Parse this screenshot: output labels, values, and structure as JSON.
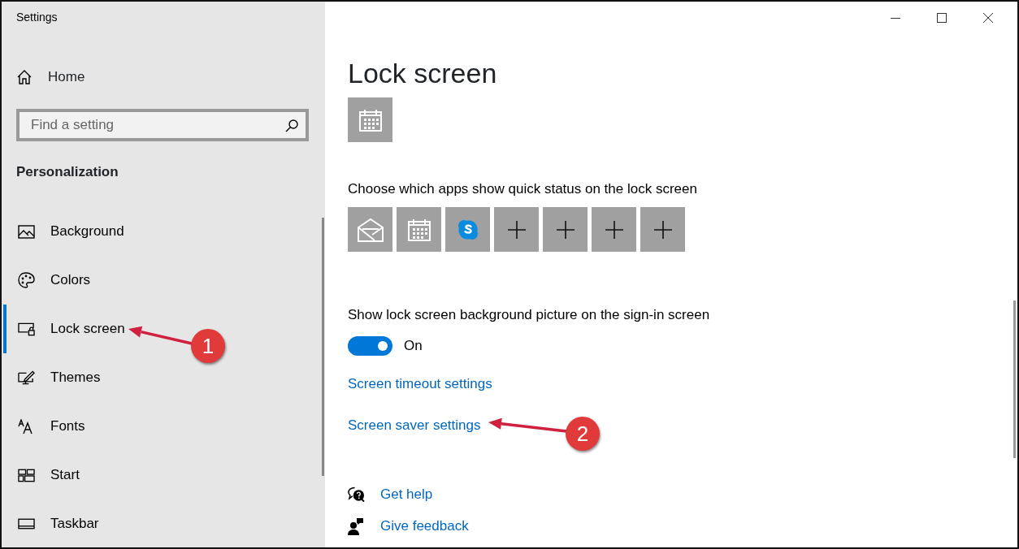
{
  "window": {
    "title": "Settings",
    "controls": [
      {
        "kind": "minimize"
      },
      {
        "kind": "maximize"
      },
      {
        "kind": "close"
      }
    ]
  },
  "sidebar": {
    "home": "Home",
    "search": {
      "placeholder": "Find a setting"
    },
    "section": "Personalization",
    "items": [
      {
        "label": "Background",
        "kind": "background",
        "selected": false
      },
      {
        "label": "Colors",
        "kind": "colors",
        "selected": false
      },
      {
        "label": "Lock screen",
        "kind": "lock",
        "selected": true
      },
      {
        "label": "Themes",
        "kind": "themes",
        "selected": false
      },
      {
        "label": "Fonts",
        "kind": "fonts",
        "selected": false
      },
      {
        "label": "Start",
        "kind": "start",
        "selected": false
      },
      {
        "label": "Taskbar",
        "kind": "taskbar",
        "selected": false
      }
    ]
  },
  "main": {
    "title": "Lock screen",
    "detailed_status": [
      {
        "kind": "calendar"
      }
    ],
    "quick_status_label": "Choose which apps show quick status on the lock screen",
    "quick_status": [
      {
        "kind": "mail"
      },
      {
        "kind": "calendar"
      },
      {
        "kind": "skype"
      },
      {
        "kind": "add"
      },
      {
        "kind": "add"
      },
      {
        "kind": "add"
      },
      {
        "kind": "add"
      }
    ],
    "toggle": {
      "label": "Show lock screen background picture on the sign-in screen",
      "on": true,
      "state_text": "On"
    },
    "links": [
      "Screen timeout settings",
      "Screen saver settings"
    ],
    "help": [
      {
        "kind": "help",
        "label": "Get help"
      },
      {
        "kind": "feedback",
        "label": "Give feedback"
      }
    ]
  },
  "annotations": [
    {
      "number": "1"
    },
    {
      "number": "2"
    }
  ]
}
